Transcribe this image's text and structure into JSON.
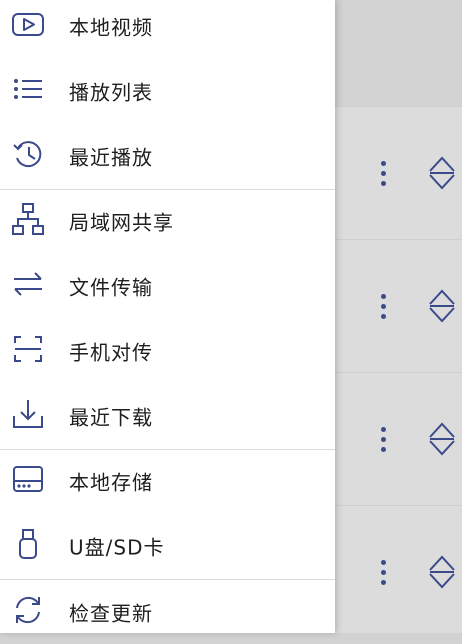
{
  "colors": {
    "icon": "#3a4a8a",
    "text": "#1e1e1e",
    "background_list": "#dcdcdc",
    "drawer": "#ffffff"
  },
  "drawer": {
    "items": [
      {
        "label": "本地视频",
        "icon": "play-box-icon"
      },
      {
        "label": "播放列表",
        "icon": "list-icon"
      },
      {
        "label": "最近播放",
        "icon": "history-icon"
      },
      {
        "label": "局域网共享",
        "icon": "network-icon"
      },
      {
        "label": "文件传输",
        "icon": "transfer-icon"
      },
      {
        "label": "手机对传",
        "icon": "scan-icon"
      },
      {
        "label": "最近下载",
        "icon": "download-icon"
      },
      {
        "label": "本地存储",
        "icon": "hard-drive-icon"
      },
      {
        "label": "U盘/SD卡",
        "icon": "usb-icon"
      },
      {
        "label": "检查更新",
        "icon": "refresh-icon"
      }
    ]
  }
}
